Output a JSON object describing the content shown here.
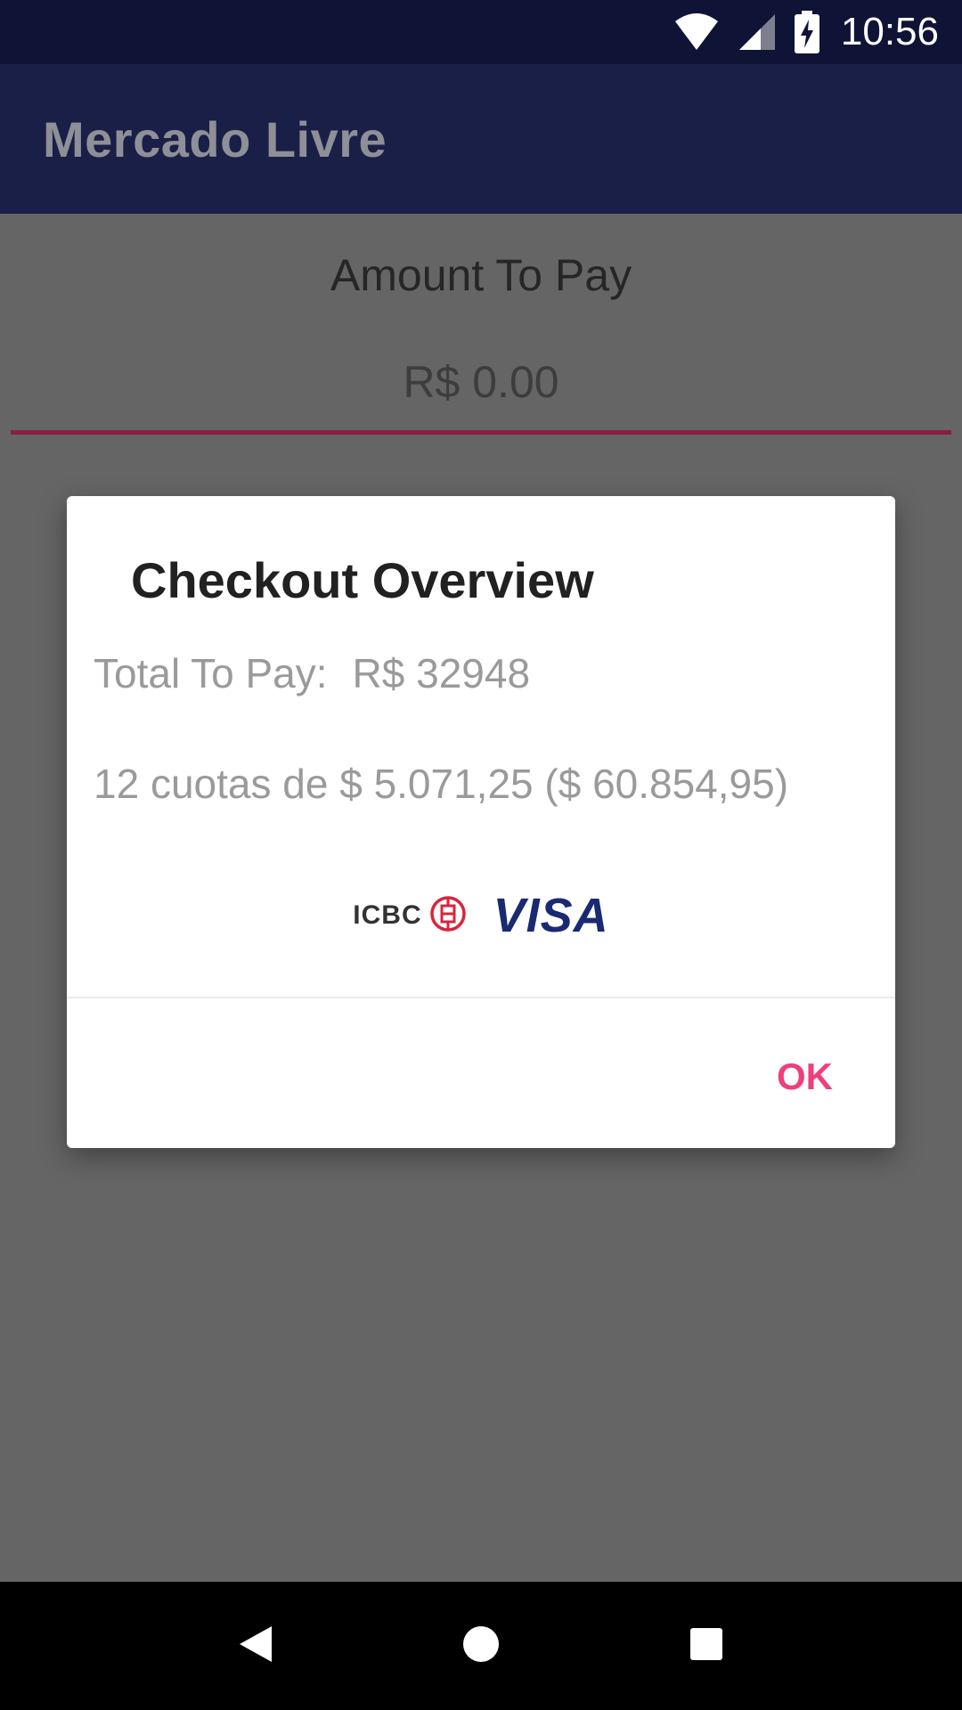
{
  "status_bar": {
    "time": "10:56",
    "icons": [
      "wifi-icon",
      "cellular-signal-icon",
      "battery-charging-icon"
    ]
  },
  "app_bar": {
    "title": "Mercado Livre"
  },
  "form": {
    "amount_label": "Amount To Pay",
    "amount_value": "R$ 0.00"
  },
  "dialog": {
    "title": "Checkout Overview",
    "total_label": "Total To Pay:",
    "total_value": "R$ 32948",
    "installments": "12 cuotas de $ 5.071,25 ($ 60.854,95)",
    "bank_logo_text": "ICBC",
    "card_logo_text": "VISA",
    "ok_label": "OK"
  },
  "nav_bar": {
    "icons": [
      "back-icon",
      "home-icon",
      "recents-icon"
    ]
  },
  "colors": {
    "status_bar": "#0f1437",
    "app_bar": "#1a1f48",
    "accent": "#ef3f7b",
    "underline": "#8a1d45",
    "scrim": "#656565"
  }
}
